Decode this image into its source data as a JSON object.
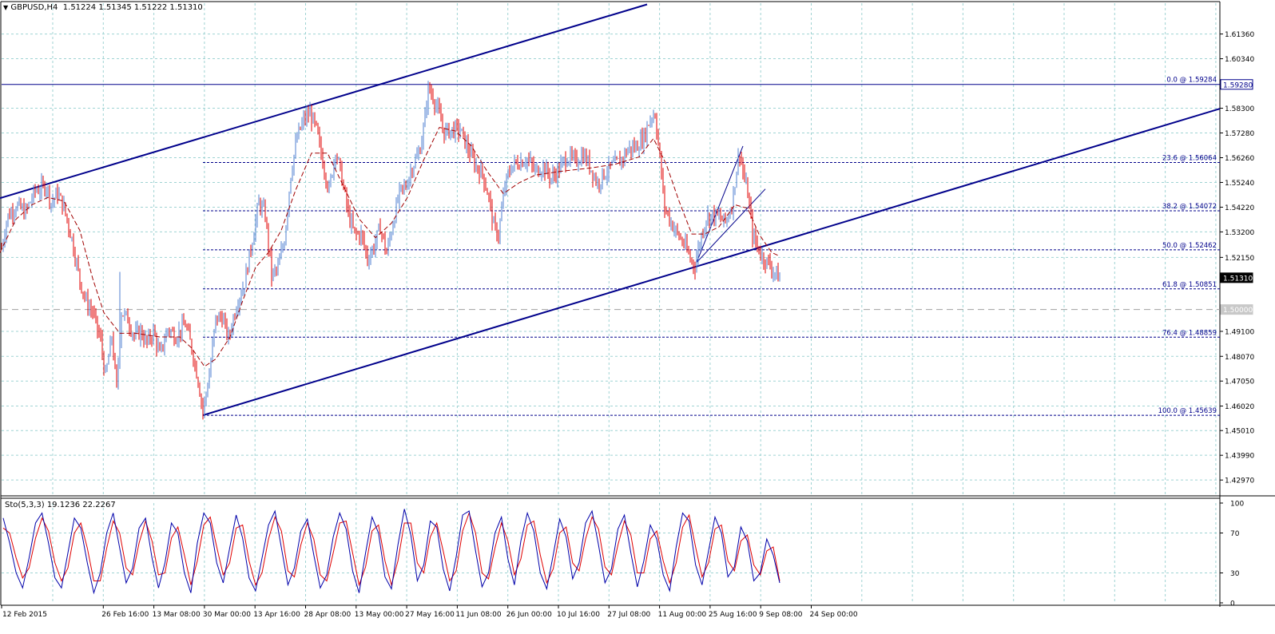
{
  "header": {
    "symbol": "GBPUSD,H4",
    "open": "1.51224",
    "high": "1.51345",
    "low": "1.51222",
    "close": "1.51310",
    "indicator": "Sto(5,3,3) 19.1236 22.2267"
  },
  "colors": {
    "grid": "#9fd3d3",
    "bull_candle": "#4f7fd0",
    "bear_candle": "#e00000",
    "trendline": "#00008b",
    "fib": "#00008b",
    "ma": "#a00000",
    "stoch_main": "#0000aa",
    "stoch_signal": "#e00000"
  },
  "chart_data": [
    {
      "type": "line",
      "title": "GBPUSD,H4",
      "ylim": [
        1.4235,
        1.6263
      ],
      "x_start_label": "12 Feb 2015",
      "x_ticks": [
        "12 Feb 2015",
        "26 Feb 16:00",
        "13 Mar 08:00",
        "30 Mar 00:00",
        "13 Apr 16:00",
        "28 Apr 08:00",
        "13 May 00:00",
        "27 May 16:00",
        "11 Jun 08:00",
        "26 Jun 00:00",
        "10 Jul 16:00",
        "27 Jul 08:00",
        "11 Aug 00:00",
        "25 Aug 16:00",
        "9 Sep 08:00",
        "24 Sep 00:00"
      ],
      "y_ticks": [
        "1.61360",
        "1.60340",
        "1.58300",
        "1.57280",
        "1.56260",
        "1.55240",
        "1.54220",
        "1.53200",
        "1.52150",
        "1.49100",
        "1.48070",
        "1.47050",
        "1.46020",
        "1.45010",
        "1.43990",
        "1.42970"
      ],
      "price_labels": [
        {
          "text": "1.59280",
          "value": 1.5928,
          "style": "filled"
        },
        {
          "text": "1.51310",
          "value": 1.5131,
          "style": "dark"
        },
        {
          "text": "1.50000",
          "value": 1.5,
          "style": "gray"
        }
      ],
      "horizontal_lines": [
        {
          "value": 1.5928,
          "style": "solid"
        },
        {
          "value": 1.5,
          "style": "dashed-gray"
        }
      ],
      "series": [
        {
          "name": "",
          "points": [
            [
              0,
              1.522
            ],
            [
              9,
              1.538
            ],
            [
              20,
              1.543
            ],
            [
              32,
              1.54
            ],
            [
              44,
              1.549
            ],
            [
              58,
              1.551
            ],
            [
              64,
              1.544
            ],
            [
              72,
              1.548
            ],
            [
              80,
              1.542
            ],
            [
              90,
              1.529
            ],
            [
              100,
              1.512
            ],
            [
              108,
              1.503
            ],
            [
              116,
              1.499
            ],
            [
              126,
              1.487
            ],
            [
              132,
              1.472
            ],
            [
              140,
              1.489
            ],
            [
              146,
              1.467
            ],
            [
              152,
              1.499
            ],
            [
              160,
              1.496
            ],
            [
              168,
              1.489
            ],
            [
              176,
              1.491
            ],
            [
              184,
              1.486
            ],
            [
              192,
              1.491
            ],
            [
              200,
              1.481
            ],
            [
              210,
              1.492
            ],
            [
              220,
              1.489
            ],
            [
              232,
              1.494
            ],
            [
              240,
              1.484
            ],
            [
              248,
              1.471
            ],
            [
              254,
              1.458
            ],
            [
              262,
              1.473
            ],
            [
              270,
              1.496
            ],
            [
              278,
              1.497
            ],
            [
              286,
              1.488
            ],
            [
              296,
              1.502
            ],
            [
              306,
              1.511
            ],
            [
              316,
              1.529
            ],
            [
              324,
              1.544
            ],
            [
              332,
              1.539
            ],
            [
              340,
              1.514
            ],
            [
              348,
              1.517
            ],
            [
              356,
              1.529
            ],
            [
              364,
              1.556
            ],
            [
              372,
              1.571
            ],
            [
              380,
              1.578
            ],
            [
              388,
              1.581
            ],
            [
              396,
              1.574
            ],
            [
              404,
              1.561
            ],
            [
              412,
              1.549
            ],
            [
              420,
              1.566
            ],
            [
              428,
              1.554
            ],
            [
              436,
              1.539
            ],
            [
              444,
              1.531
            ],
            [
              452,
              1.531
            ],
            [
              460,
              1.521
            ],
            [
              468,
              1.526
            ],
            [
              476,
              1.534
            ],
            [
              484,
              1.523
            ],
            [
              492,
              1.536
            ],
            [
              500,
              1.548
            ],
            [
              508,
              1.551
            ],
            [
              516,
              1.559
            ],
            [
              524,
              1.564
            ],
            [
              530,
              1.574
            ],
            [
              536,
              1.591
            ],
            [
              542,
              1.588
            ],
            [
              548,
              1.582
            ],
            [
              556,
              1.573
            ],
            [
              566,
              1.574
            ],
            [
              576,
              1.574
            ],
            [
              586,
              1.566
            ],
            [
              596,
              1.559
            ],
            [
              604,
              1.556
            ],
            [
              612,
              1.546
            ],
            [
              618,
              1.534
            ],
            [
              624,
              1.531
            ],
            [
              632,
              1.551
            ],
            [
              640,
              1.559
            ],
            [
              650,
              1.561
            ],
            [
              660,
              1.562
            ],
            [
              670,
              1.557
            ],
            [
              680,
              1.559
            ],
            [
              690,
              1.554
            ],
            [
              700,
              1.558
            ],
            [
              710,
              1.563
            ],
            [
              720,
              1.561
            ],
            [
              730,
              1.564
            ],
            [
              740,
              1.558
            ],
            [
              748,
              1.552
            ],
            [
              756,
              1.556
            ],
            [
              766,
              1.559
            ],
            [
              776,
              1.561
            ],
            [
              786,
              1.566
            ],
            [
              796,
              1.567
            ],
            [
              806,
              1.571
            ],
            [
              814,
              1.579
            ],
            [
              820,
              1.581
            ],
            [
              826,
              1.562
            ],
            [
              832,
              1.542
            ],
            [
              840,
              1.536
            ],
            [
              848,
              1.531
            ],
            [
              856,
              1.527
            ],
            [
              864,
              1.521
            ],
            [
              870,
              1.518
            ],
            [
              876,
              1.528
            ],
            [
              884,
              1.538
            ],
            [
              892,
              1.539
            ],
            [
              900,
              1.538
            ],
            [
              908,
              1.536
            ],
            [
              916,
              1.543
            ],
            [
              922,
              1.558
            ],
            [
              926,
              1.565
            ],
            [
              932,
              1.553
            ],
            [
              936,
              1.548
            ],
            [
              942,
              1.531
            ],
            [
              948,
              1.526
            ],
            [
              954,
              1.522
            ],
            [
              962,
              1.519
            ],
            [
              968,
              1.516
            ],
            [
              976,
              1.513
            ]
          ]
        },
        {
          "name": "",
          "points": [
            [
              0,
              1.5235
            ],
            [
              20,
              1.5372
            ],
            [
              40,
              1.5432
            ],
            [
              60,
              1.5462
            ],
            [
              80,
              1.5447
            ],
            [
              100,
              1.5326
            ],
            [
              116,
              1.5128
            ],
            [
              130,
              1.4987
            ],
            [
              150,
              1.4902
            ],
            [
              170,
              1.4902
            ],
            [
              200,
              1.4887
            ],
            [
              225,
              1.4887
            ],
            [
              240,
              1.4841
            ],
            [
              256,
              1.4765
            ],
            [
              270,
              1.4796
            ],
            [
              288,
              1.4887
            ],
            [
              304,
              1.5038
            ],
            [
              320,
              1.5174
            ],
            [
              336,
              1.5235
            ],
            [
              352,
              1.5326
            ],
            [
              370,
              1.5492
            ],
            [
              390,
              1.5645
            ],
            [
              410,
              1.5645
            ],
            [
              430,
              1.5508
            ],
            [
              450,
              1.5372
            ],
            [
              470,
              1.5296
            ],
            [
              490,
              1.5356
            ],
            [
              510,
              1.5462
            ],
            [
              530,
              1.5614
            ],
            [
              550,
              1.5751
            ],
            [
              570,
              1.5736
            ],
            [
              590,
              1.5675
            ],
            [
              610,
              1.5569
            ],
            [
              630,
              1.5478
            ],
            [
              650,
              1.5523
            ],
            [
              670,
              1.5554
            ],
            [
              700,
              1.5569
            ],
            [
              740,
              1.5584
            ],
            [
              770,
              1.5599
            ],
            [
              800,
              1.5629
            ],
            [
              818,
              1.5705
            ],
            [
              834,
              1.5599
            ],
            [
              850,
              1.5447
            ],
            [
              866,
              1.5311
            ],
            [
              882,
              1.5311
            ],
            [
              900,
              1.5341
            ],
            [
              920,
              1.5432
            ],
            [
              936,
              1.5417
            ],
            [
              950,
              1.5311
            ],
            [
              966,
              1.5235
            ],
            [
              976,
              1.522
            ]
          ]
        }
      ],
      "channels": [
        {
          "p1": [
            0,
            1.5459
          ],
          "p2": [
            810,
            1.6258
          ]
        },
        {
          "p1": [
            254,
            1.4564
          ],
          "p2": [
            1527,
            1.5828
          ]
        },
        {
          "p1": [
            872,
            1.5194
          ],
          "p2": [
            930,
            1.5674
          ]
        },
        {
          "p1": [
            872,
            1.5194
          ],
          "p2": [
            958,
            1.5497
          ]
        }
      ],
      "fibonacci": {
        "x_start": 254,
        "x_end": 1527,
        "levels": [
          {
            "label": "0.0 @ 1.59284",
            "value": 1.59284
          },
          {
            "label": "23.6 @ 1.56064",
            "value": 1.56064
          },
          {
            "label": "38.2 @ 1.54072",
            "value": 1.54072
          },
          {
            "label": "50.0 @ 1.52462",
            "value": 1.52462
          },
          {
            "label": "61.8 @ 1.50851",
            "value": 1.50851
          },
          {
            "label": "76.4 @ 1.48859",
            "value": 1.48859
          },
          {
            "label": "100.0 @ 1.45639",
            "value": 1.45639
          }
        ]
      },
      "grid": true
    },
    {
      "type": "line",
      "title": "Sto(5,3,3) 19.1236 22.2267",
      "ylim": [
        0,
        100
      ],
      "y_ticks": [
        "100",
        "70",
        "30",
        "0"
      ],
      "levels": [
        70,
        30
      ],
      "series": [
        {
          "name": "",
          "values": [
            85,
            60,
            30,
            15,
            45,
            80,
            90,
            60,
            25,
            15,
            50,
            85,
            75,
            40,
            10,
            30,
            70,
            90,
            55,
            20,
            35,
            75,
            85,
            45,
            15,
            40,
            80,
            70,
            30,
            10,
            60,
            90,
            80,
            40,
            20,
            55,
            88,
            65,
            25,
            12,
            45,
            78,
            92,
            55,
            18,
            35,
            72,
            84,
            48,
            15,
            28,
            66,
            90,
            74,
            32,
            10,
            50,
            86,
            70,
            26,
            14,
            58,
            94,
            68,
            22,
            38,
            82,
            76,
            34,
            12,
            46,
            88,
            92,
            52,
            16,
            30,
            70,
            86,
            44,
            18,
            62,
            90,
            72,
            30,
            14,
            48,
            84,
            66,
            24,
            40,
            80,
            92,
            58,
            20,
            34,
            74,
            88,
            50,
            16,
            42,
            78,
            64,
            28,
            12,
            56,
            90,
            82,
            38,
            18,
            52,
            86,
            70,
            26,
            36,
            76,
            62,
            22,
            30,
            64,
            48,
            20
          ]
        },
        {
          "name": "",
          "values": [
            75,
            70,
            45,
            25,
            35,
            65,
            85,
            72,
            40,
            22,
            35,
            70,
            80,
            55,
            22,
            22,
            55,
            82,
            70,
            35,
            28,
            60,
            82,
            62,
            28,
            30,
            65,
            76,
            48,
            18,
            42,
            78,
            86,
            56,
            28,
            40,
            75,
            78,
            42,
            18,
            30,
            64,
            86,
            72,
            32,
            26,
            58,
            80,
            64,
            28,
            22,
            50,
            80,
            82,
            50,
            18,
            36,
            72,
            78,
            42,
            18,
            42,
            80,
            80,
            40,
            30,
            66,
            80,
            52,
            22,
            32,
            72,
            90,
            70,
            30,
            24,
            55,
            80,
            62,
            28,
            44,
            78,
            82,
            48,
            20,
            34,
            70,
            76,
            40,
            32,
            64,
            86,
            74,
            36,
            28,
            58,
            82,
            68,
            30,
            30,
            64,
            72,
            42,
            20,
            40,
            76,
            88,
            56,
            26,
            40,
            74,
            78,
            42,
            32,
            62,
            68,
            38,
            28,
            52,
            56,
            22
          ]
        }
      ]
    }
  ]
}
